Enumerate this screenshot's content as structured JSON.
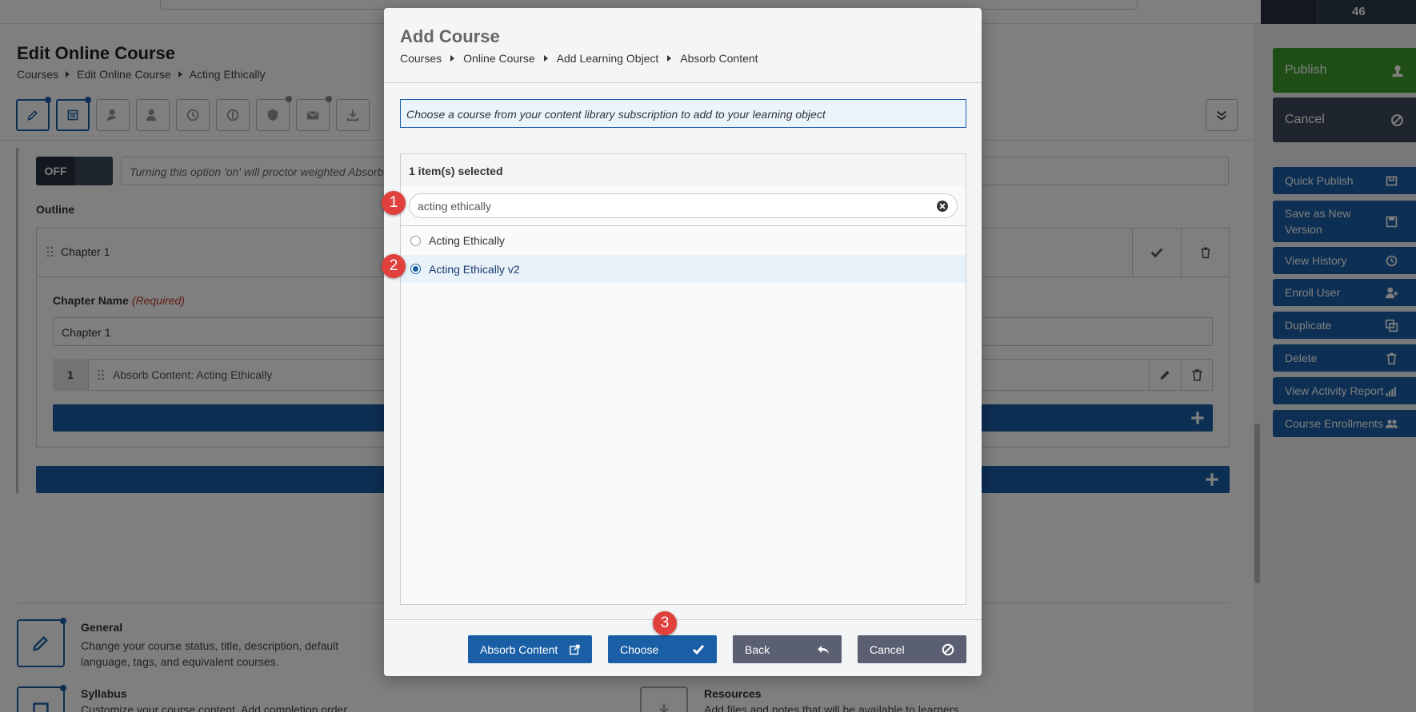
{
  "page": {
    "title": "Edit Online Course",
    "breadcrumb": [
      "Courses",
      "Edit Online Course",
      "Acting Ethically"
    ],
    "proctor_toggle": "OFF",
    "proctor_note": "Turning this option 'on' will proctor weighted Absorb",
    "outline_label": "Outline",
    "chapter_header": "Chapter 1",
    "chapter_name_label": "Chapter Name",
    "chapter_name_required": "(Required)",
    "chapter_name_value": "Chapter 1",
    "learning_object": {
      "number": "1",
      "text": "Absorb Content:  Acting Ethically"
    },
    "cards": [
      {
        "title": "General",
        "desc": "Change your course status, title, description, default language, tags, and equivalent courses."
      },
      {
        "title": "Syllabus",
        "desc": "Customize your course content. Add completion order"
      },
      {
        "title": "Resources",
        "desc": "Add files and notes that will be available to learners"
      }
    ]
  },
  "top_nav": {
    "count": "46"
  },
  "side_panel": {
    "publish": "Publish",
    "cancel": "Cancel",
    "actions": [
      {
        "label": "Quick Publish",
        "icon": "quick-publish-icon"
      },
      {
        "label": "Save as New Version",
        "icon": "save-icon"
      },
      {
        "label": "View History",
        "icon": "history-icon"
      },
      {
        "label": "Enroll User",
        "icon": "enroll-user-icon"
      },
      {
        "label": "Duplicate",
        "icon": "duplicate-icon"
      },
      {
        "label": "Delete",
        "icon": "trash-icon"
      },
      {
        "label": "View Activity Report",
        "icon": "bar-chart-icon"
      },
      {
        "label": "Course Enrollments",
        "icon": "users-icon"
      }
    ]
  },
  "modal": {
    "title": "Add Course",
    "breadcrumb": [
      "Courses",
      "Online Course",
      "Add Learning Object",
      "Absorb Content"
    ],
    "info": "Choose a course from your content library subscription to add to your learning object",
    "selected_count": "1 item(s) selected",
    "search_value": "acting ethically",
    "options": [
      {
        "label": "Acting Ethically",
        "selected": false
      },
      {
        "label": "Acting Ethically v2",
        "selected": true
      }
    ],
    "buttons": {
      "absorb": "Absorb Content",
      "choose": "Choose",
      "back": "Back",
      "cancel": "Cancel"
    }
  },
  "steps": [
    "1",
    "2",
    "3"
  ],
  "colors": {
    "primary": "#1a5fa6",
    "publish": "#3d9a2a",
    "dark": "#3e4a5c",
    "step_marker": "#e0413d"
  }
}
